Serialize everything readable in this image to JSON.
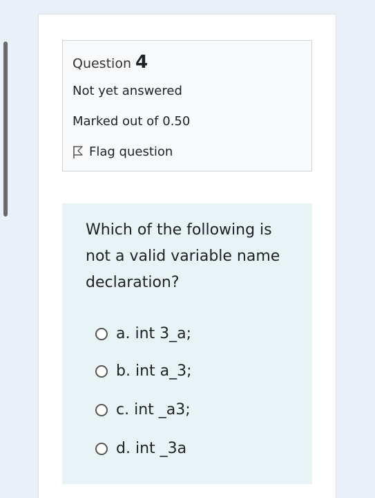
{
  "question": {
    "label": "Question",
    "number": "4",
    "status": "Not yet answered",
    "marks": "Marked out of 0.50",
    "flag_label": "Flag question",
    "flag_icon": "flag-icon"
  },
  "prompt": "Which of the following is not a valid variable name declaration?",
  "options": [
    {
      "label": "a. int 3_a;"
    },
    {
      "label": "b.  int a_3;"
    },
    {
      "label": "c. int _a3;"
    },
    {
      "label": "d. int _3a"
    }
  ],
  "colors": {
    "page_bg": "#eaf0f7",
    "info_bg": "#f8f9fa",
    "content_bg": "#e7f3f5",
    "text": "#1d2125"
  }
}
